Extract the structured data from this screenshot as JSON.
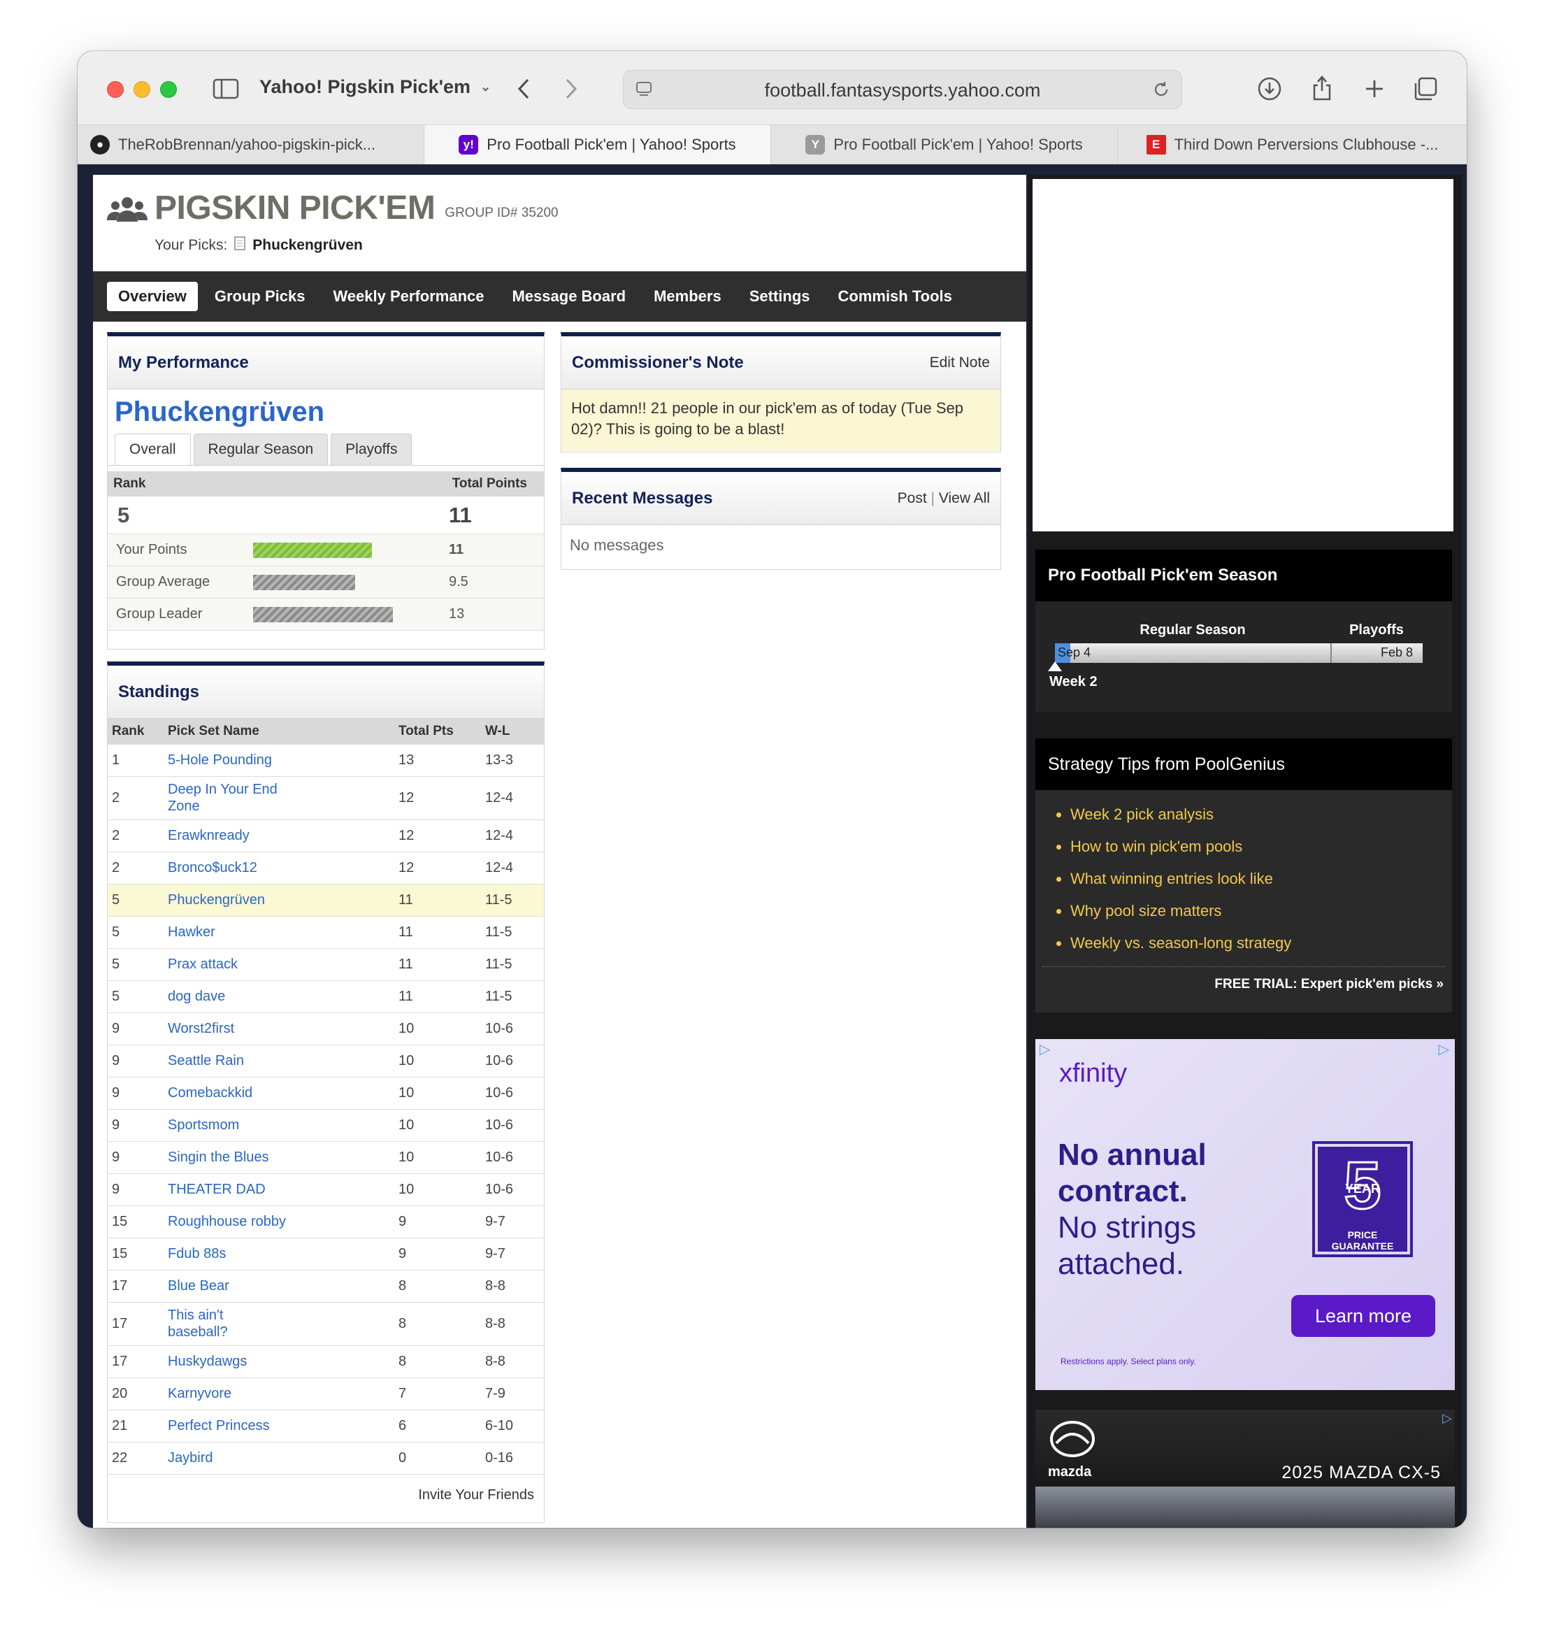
{
  "browser": {
    "tab_title": "Yahoo! Pigskin Pick'em",
    "url": "football.fantasysports.yahoo.com",
    "tabs": [
      {
        "label": "TheRobBrennan/yahoo-pigskin-pick..."
      },
      {
        "label": "Pro Football Pick'em | Yahoo! Sports"
      },
      {
        "label": "Pro Football Pick'em | Yahoo! Sports"
      },
      {
        "label": "Third Down Perversions Clubhouse -..."
      }
    ]
  },
  "header": {
    "title": "PIGSKIN PICK'EM",
    "group_id": "GROUP ID# 35200",
    "your_picks_label": "Your Picks:",
    "your_picks_name": "Phuckengrüven"
  },
  "nav": [
    "Overview",
    "Group Picks",
    "Weekly Performance",
    "Message Board",
    "Members",
    "Settings",
    "Commish Tools"
  ],
  "performance": {
    "heading": "My Performance",
    "name": "Phuckengrüven",
    "tabs": [
      "Overall",
      "Regular Season",
      "Playoffs"
    ],
    "rank_label": "Rank",
    "total_label": "Total Points",
    "rank": "5",
    "total": "11",
    "rows": [
      {
        "label": "Your Points",
        "value": "11",
        "fill": 0.85
      },
      {
        "label": "Group Average",
        "value": "9.5",
        "fill": 0.73
      },
      {
        "label": "Group Leader",
        "value": "13",
        "fill": 1.0
      }
    ]
  },
  "standings": {
    "heading": "Standings",
    "columns": [
      "Rank",
      "Pick Set Name",
      "Total Pts",
      "W-L"
    ],
    "rows": [
      {
        "rank": "1",
        "name": "5-Hole Pounding",
        "pts": "13",
        "wl": "13-3"
      },
      {
        "rank": "2",
        "name": "Deep In Your End Zone",
        "pts": "12",
        "wl": "12-4"
      },
      {
        "rank": "2",
        "name": "Erawknready",
        "pts": "12",
        "wl": "12-4"
      },
      {
        "rank": "2",
        "name": "Bronco$uck12",
        "pts": "12",
        "wl": "12-4"
      },
      {
        "rank": "5",
        "name": "Phuckengrüven",
        "pts": "11",
        "wl": "11-5"
      },
      {
        "rank": "5",
        "name": "Hawker",
        "pts": "11",
        "wl": "11-5"
      },
      {
        "rank": "5",
        "name": "Prax attack",
        "pts": "11",
        "wl": "11-5"
      },
      {
        "rank": "5",
        "name": "dog dave",
        "pts": "11",
        "wl": "11-5"
      },
      {
        "rank": "9",
        "name": "Worst2first",
        "pts": "10",
        "wl": "10-6"
      },
      {
        "rank": "9",
        "name": "Seattle Rain",
        "pts": "10",
        "wl": "10-6"
      },
      {
        "rank": "9",
        "name": "Comebackkid",
        "pts": "10",
        "wl": "10-6"
      },
      {
        "rank": "9",
        "name": "Sportsmom",
        "pts": "10",
        "wl": "10-6"
      },
      {
        "rank": "9",
        "name": "Singin the Blues",
        "pts": "10",
        "wl": "10-6"
      },
      {
        "rank": "9",
        "name": "THEATER DAD",
        "pts": "10",
        "wl": "10-6"
      },
      {
        "rank": "15",
        "name": "Roughhouse robby",
        "pts": "9",
        "wl": "9-7"
      },
      {
        "rank": "15",
        "name": "Fdub 88s",
        "pts": "9",
        "wl": "9-7"
      },
      {
        "rank": "17",
        "name": "Blue Bear",
        "pts": "8",
        "wl": "8-8"
      },
      {
        "rank": "17",
        "name": "This ain't baseball?",
        "pts": "8",
        "wl": "8-8"
      },
      {
        "rank": "17",
        "name": "Huskydawgs",
        "pts": "8",
        "wl": "8-8"
      },
      {
        "rank": "20",
        "name": "Karnyvore",
        "pts": "7",
        "wl": "7-9"
      },
      {
        "rank": "21",
        "name": "Perfect Princess",
        "pts": "6",
        "wl": "6-10"
      },
      {
        "rank": "22",
        "name": "Jaybird",
        "pts": "0",
        "wl": "0-16"
      }
    ],
    "invite": "Invite Your Friends"
  },
  "commish": {
    "heading": "Commissioner's Note",
    "edit": "Edit Note",
    "note": "Hot damn!! 21 people in our pick'em as of today (Tue Sep 02)? This is going to be a blast!"
  },
  "messages": {
    "heading": "Recent Messages",
    "post": "Post",
    "view_all": "View All",
    "empty": "No messages"
  },
  "season": {
    "heading": "Pro Football Pick'em Season",
    "regular": "Regular Season",
    "playoffs": "Playoffs",
    "start": "Sep 4",
    "end": "Feb 8",
    "week": "Week 2"
  },
  "tips": {
    "heading": "Strategy Tips from PoolGenius",
    "items": [
      "Week 2 pick analysis",
      "How to win pick'em pools",
      "What winning entries look like",
      "Why pool size matters",
      "Weekly vs. season-long strategy"
    ],
    "trial": "FREE TRIAL: Expert pick'em picks »"
  },
  "ad_xfinity": {
    "brand": "xfinity",
    "line1": "No annual contract.",
    "line2": "No strings attached.",
    "badge_num": "5",
    "badge_year": "YEAR",
    "badge_sub": "PRICE GUARANTEE",
    "cta": "Learn more",
    "fine": "Restrictions apply. Select plans only."
  },
  "ad_mazda": {
    "brand": "mazda",
    "model": "2025 MAZDA CX-5"
  },
  "colors": {
    "accent_blue": "#2a66c6",
    "navy": "#132259",
    "tip_yellow": "#f2c94c",
    "xfinity_purple": "#5a1ac7"
  }
}
